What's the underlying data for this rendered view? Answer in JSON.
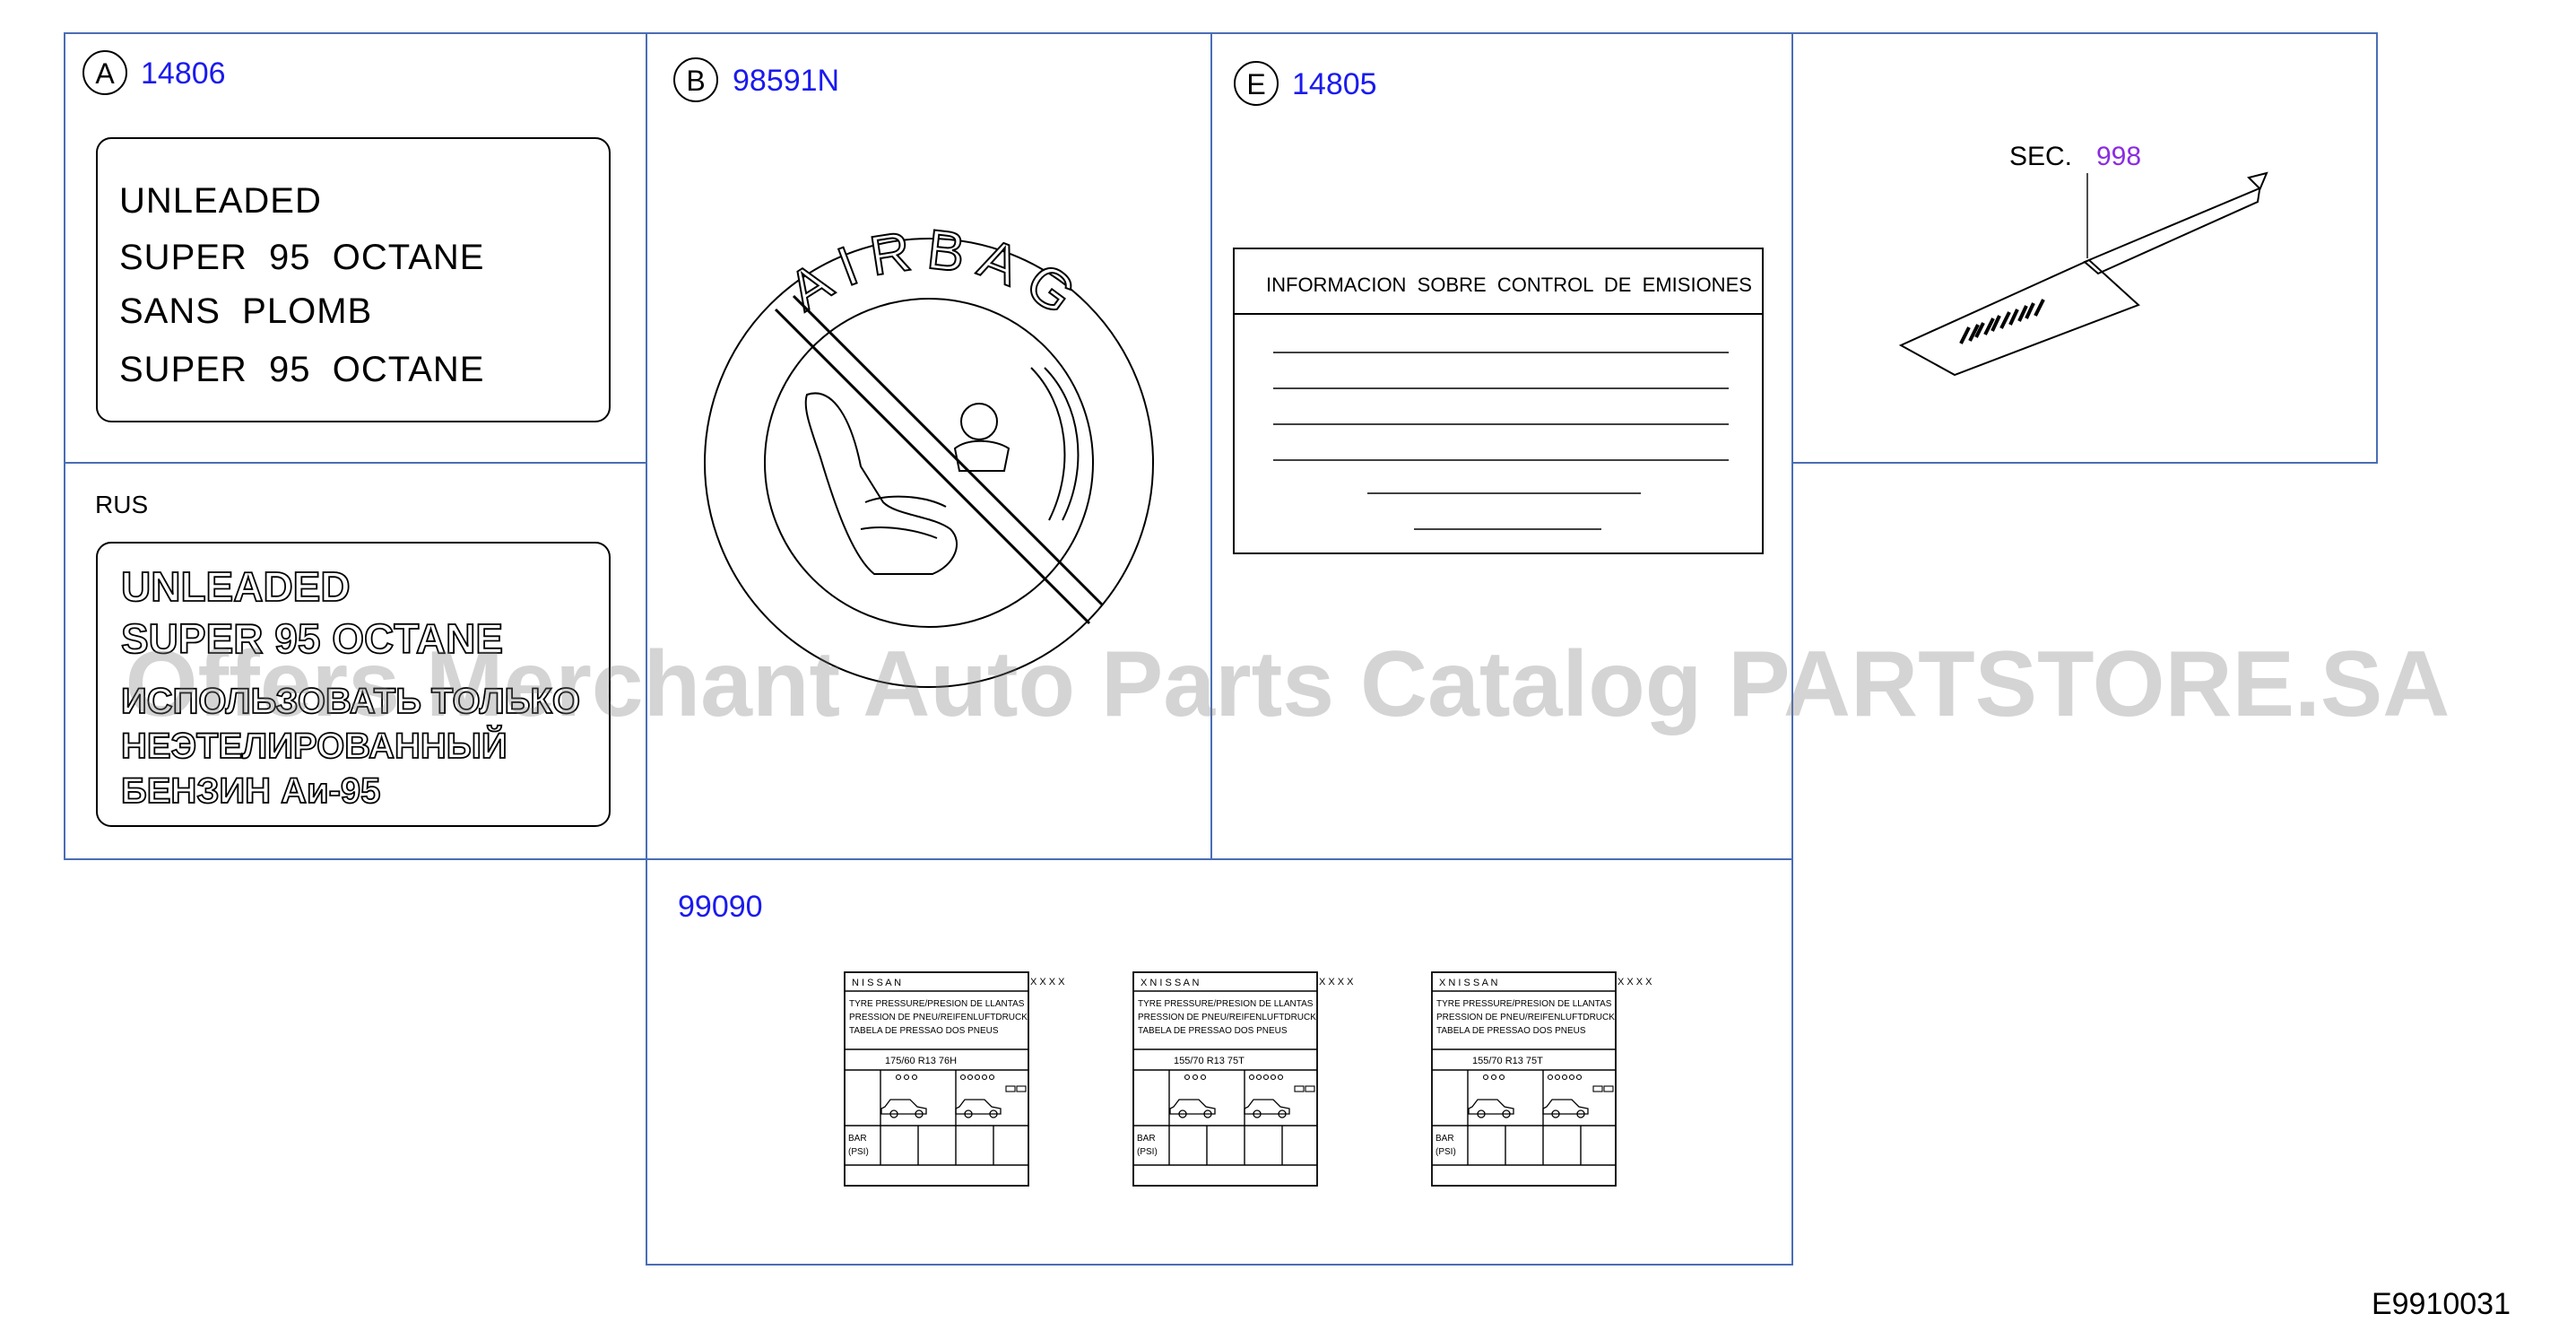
{
  "panels": {
    "a": {
      "letter": "A",
      "part_number": "14806",
      "label_lines": [
        "UNLEADED",
        "SUPER  95  OCTANE",
        "SANS  PLOMB",
        "SUPER  95  OCTANE"
      ]
    },
    "rus": {
      "region_label": "RUS",
      "label_lines": [
        "UNLEADED",
        "SUPER 95 OCTANE",
        "ИСПОЛЬЗОВАТЬ ТОЛЬКО",
        "НЕЭТЕЛИРОВАННЫЙ",
        "БЕНЗИН Аи-95"
      ]
    },
    "b": {
      "letter": "B",
      "part_number": "98591N",
      "airbag_text": "AIRBAG"
    },
    "e": {
      "letter": "E",
      "part_number": "14805",
      "emission_header": "INFORMACION  SOBRE  CONTROL  DE  EMISIONES"
    },
    "sec": {
      "sec_label": "SEC.",
      "sec_number": "998"
    },
    "tyre": {
      "part_number": "99090",
      "labels": [
        {
          "brand": "NISSAN",
          "brand_prefix": "",
          "size": "175/60   R13   76H"
        },
        {
          "brand": "NISSAN",
          "brand_prefix": "X",
          "size": "155/70   R13   75T"
        },
        {
          "brand": "NISSAN",
          "brand_prefix": "X",
          "size": "155/70   R13   75T"
        }
      ],
      "lines": [
        "TYRE  PRESSURE/PRESION  DE  LLANTAS",
        "PRESSION  DE  PNEU/REIFENLUFTDRUCK",
        "TABELA  DE  PRESSAO  DOS  PNEUS"
      ],
      "unit_bar": "BAR",
      "unit_psi": "(PSI)",
      "x_marks": "X    X    X    X"
    }
  },
  "watermark": "Offers Merchant Auto Parts Catalog PARTSTORE.SA",
  "diagram_code": "E9910031",
  "colors": {
    "frame": "#4a6db5",
    "part_number": "#1a1aee",
    "sec_number": "#8a2be2",
    "ink": "#000000",
    "watermark": "rgba(120,120,120,0.32)"
  }
}
